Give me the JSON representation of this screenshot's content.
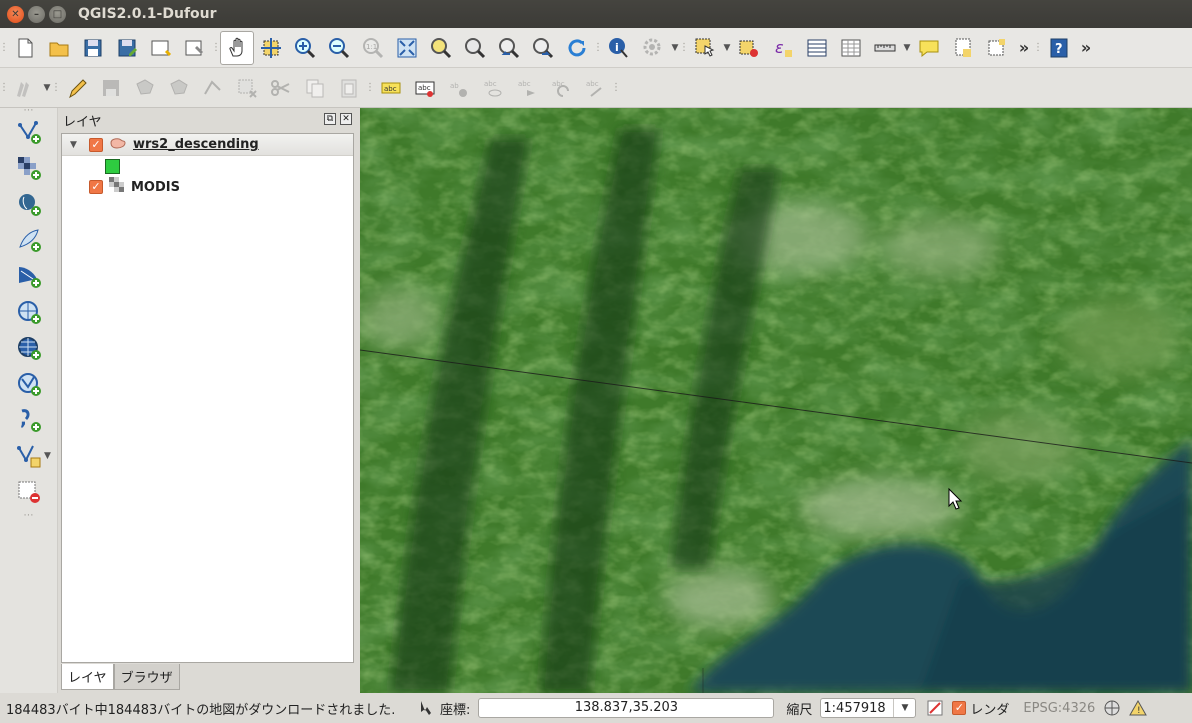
{
  "window": {
    "title": "QGIS2.0.1-Dufour"
  },
  "panel": {
    "title": "レイヤ",
    "layers": [
      {
        "name": "wrs2_descending",
        "checked": true,
        "symbol_color": "#2ecc40"
      },
      {
        "name": "MODIS",
        "checked": true
      }
    ],
    "tabs": [
      "レイヤ",
      "ブラウザ"
    ]
  },
  "toolbar": {
    "more": "»"
  },
  "statusbar": {
    "message": "184483バイト中184483バイトの地図がダウンロードされました.",
    "coord_label": "座標:",
    "coord_value": "138.837,35.203",
    "scale_label": "縮尺",
    "scale_value": "1:457918",
    "render_label": "レンダ",
    "epsg": "EPSG:4326"
  },
  "colors": {
    "titlebar": "#3c3b37",
    "close_button": "#df4a16",
    "checkbox": "#f07746",
    "map_forest": "#3f7a2a",
    "map_water": "#1c4a55"
  }
}
